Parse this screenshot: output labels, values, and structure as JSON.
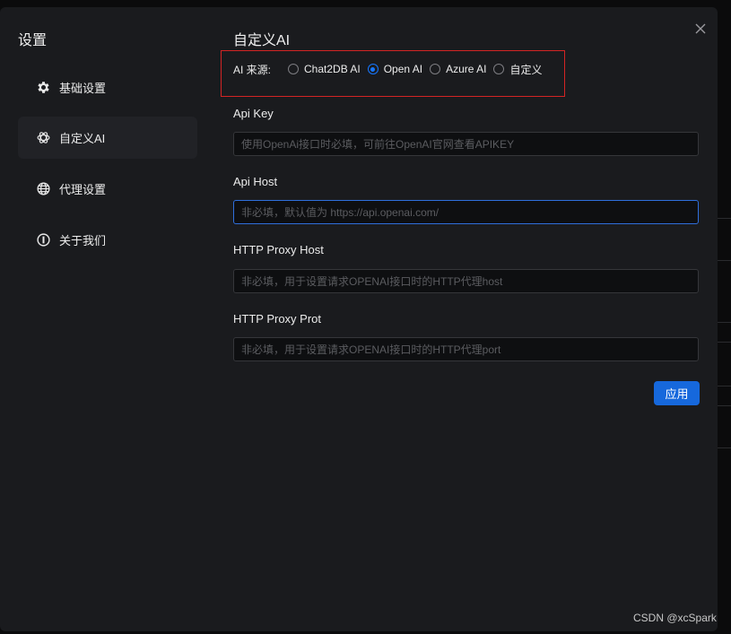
{
  "sidebar": {
    "title": "设置",
    "items": [
      {
        "label": "基础设置",
        "icon": "gear-icon"
      },
      {
        "label": "自定义AI",
        "icon": "openai-icon"
      },
      {
        "label": "代理设置",
        "icon": "globe-icon"
      },
      {
        "label": "关于我们",
        "icon": "info-icon"
      }
    ],
    "active_index": 1
  },
  "main": {
    "title": "自定义AI",
    "ai_source": {
      "label": "AI 来源:",
      "options": [
        "Chat2DB AI",
        "Open AI",
        "Azure AI",
        "自定义"
      ],
      "selected": "Open AI"
    },
    "fields": [
      {
        "label": "Api Key",
        "value": "",
        "placeholder": "使用OpenAi接口时必填，可前往OpenAI官网查看APIKEY"
      },
      {
        "label": "Api Host",
        "value": "",
        "placeholder": "非必填，默认值为 https://api.openai.com/"
      },
      {
        "label": "HTTP Proxy Host",
        "value": "",
        "placeholder": "非必填，用于设置请求OPENAI接口时的HTTP代理host"
      },
      {
        "label": "HTTP Proxy Prot",
        "value": "",
        "placeholder": "非必填，用于设置请求OPENAI接口时的HTTP代理port"
      }
    ],
    "apply_label": "应用"
  },
  "watermark": "CSDN @xcSpark",
  "colors": {
    "accent": "#1677ff",
    "button": "#1668dc",
    "highlight_border": "#d32424",
    "modal_bg": "#1a1b1e"
  }
}
